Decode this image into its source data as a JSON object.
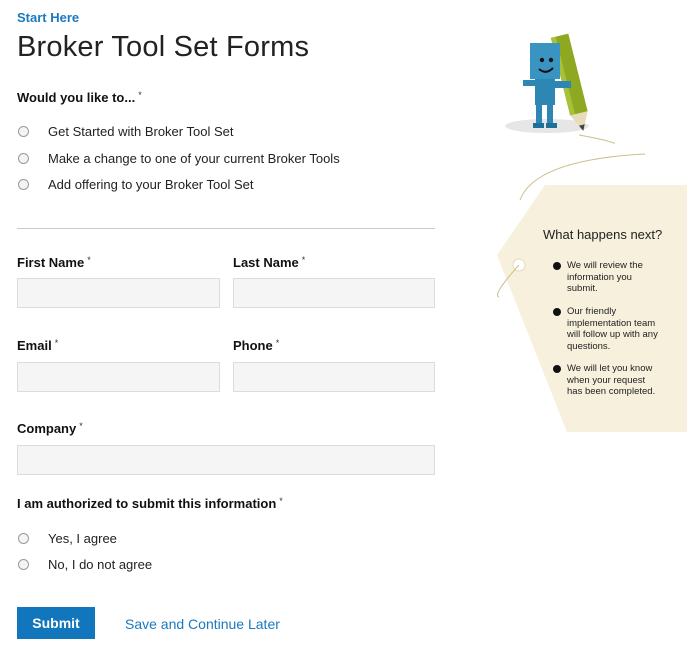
{
  "header": {
    "start_here": "Start Here",
    "title": "Broker Tool Set Forms"
  },
  "question1": {
    "label": "Would you like to...",
    "required": "*",
    "options": [
      "Get Started with Broker Tool Set",
      "Make a change to one of your current Broker Tools",
      "Add offering to your Broker Tool Set"
    ]
  },
  "fields": {
    "first_name": "First Name",
    "last_name": "Last Name",
    "email": "Email",
    "phone": "Phone",
    "company": "Company",
    "required": "*"
  },
  "authorization": {
    "label": "I am authorized to submit this information",
    "required": "*",
    "options": [
      "Yes, I agree",
      "No, I do not agree"
    ]
  },
  "actions": {
    "submit": "Submit",
    "save_later": "Save and Continue Later"
  },
  "sidebar": {
    "title": "What happens next?",
    "items": [
      "We will review the information you submit.",
      "Our friendly implementation team will follow up with any questions.",
      "We will let you know when your request has been completed."
    ]
  },
  "colors": {
    "accent": "#1176bc",
    "tag_background": "#f6f0dc",
    "mascot_blue": "#2e86b3",
    "pencil_green": "#8ea822"
  }
}
